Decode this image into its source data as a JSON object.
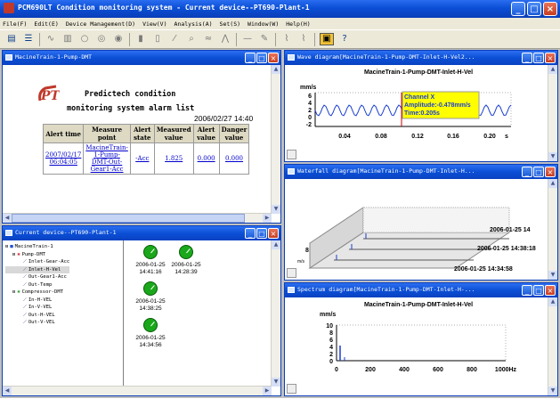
{
  "app": {
    "title": "PCM690LT Condition monitoring system  - Current device--PT690-Plant-1",
    "menu": [
      "File(F)",
      "Edit(E)",
      "Device Management(D)",
      "View(V)",
      "Analysis(A)",
      "Set(S)",
      "Window(W)",
      "Help(H)"
    ]
  },
  "alarm_window": {
    "title": "MacineTrain-1-Pump-DMT",
    "logo_text": "PT",
    "heading_line1": "Predictech condition",
    "heading_line2": "monitoring system alarm list",
    "datetime": "2006/02/27 14:40",
    "headers": [
      "Alert time",
      "Measure point",
      "Alert state",
      "Measured value",
      "Alert value",
      "Danger value"
    ],
    "row": [
      "2007/02/17 06:04:05",
      "MacineTrain-1-Pump-DMT-Out-Gear1-Acc",
      "-Acc",
      "1.825",
      "0.000",
      "0.000"
    ]
  },
  "device_window": {
    "title": "Current device--PT690-Plant-1",
    "tree": [
      {
        "label": "MacineTrain-1",
        "level": 0,
        "icon": "train-icon"
      },
      {
        "label": "Pump-DMT",
        "level": 1,
        "icon": "pump-icon"
      },
      {
        "label": "Inlet-Gear-Acc",
        "level": 2,
        "icon": "sensor-icon"
      },
      {
        "label": "Inlet-H-Vel",
        "level": 2,
        "icon": "sensor-icon"
      },
      {
        "label": "Out-Gear1-Acc",
        "level": 2,
        "icon": "sensor-icon"
      },
      {
        "label": "Out-Temp",
        "level": 2,
        "icon": "sensor-icon"
      },
      {
        "label": "Compressor-DMT",
        "level": 1,
        "icon": "compressor-icon"
      },
      {
        "label": "In-H-VEL",
        "level": 2,
        "icon": "sensor-icon"
      },
      {
        "label": "In-V-VEL",
        "level": 2,
        "icon": "sensor-icon"
      },
      {
        "label": "Out-H-VEL",
        "level": 2,
        "icon": "sensor-icon"
      },
      {
        "label": "Out-V-VEL",
        "level": 2,
        "icon": "sensor-icon"
      }
    ],
    "records": [
      {
        "date": "2006-01-25",
        "time": "14:41:16"
      },
      {
        "date": "2006-01-25",
        "time": "14:28:39"
      },
      {
        "date": "2006-01-25",
        "time": "14:38:25"
      },
      {
        "date": "2006-01-25",
        "time": "14:34:56"
      }
    ]
  },
  "wave_window": {
    "title": "Wave diagram[MacineTrain-1-Pump-DMT-Inlet-H-Vel2...",
    "chart_title": "MacineTrain-1-Pump-DMT-Inlet-H-Vel",
    "unit": "mm/s",
    "yticks": [
      "6",
      "4",
      "2",
      "0",
      "-2"
    ],
    "xticks": [
      "0.04",
      "0.08",
      "0.12",
      "0.16",
      "0.20"
    ],
    "xunit": "s",
    "tooltip": [
      "Channel X",
      "Amplitude:-0.478mm/s",
      "Time:0.205s"
    ],
    "accent": "#ffff00"
  },
  "waterfall_window": {
    "title": "Waterfall diagram[MacineTrain-1-Pump-DMT-Inlet-H...",
    "labels": [
      "2006-01-25 14",
      "2006-01-25 14:38:18",
      "2006-01-25 14:34:58"
    ],
    "zlabel": "8",
    "corner": "m/s"
  },
  "spectrum_window": {
    "title": "Spectrum diagram[MacineTrain-1-Pump-DMT-Inlet-H-...",
    "chart_title": "MacineTrain-1-Pump-DMT-Inlet-H-Vel",
    "unit": "mm/s",
    "yticks": [
      "10",
      "8",
      "6",
      "4",
      "2",
      "0"
    ],
    "xticks": [
      "0",
      "200",
      "400",
      "600",
      "800",
      "1000Hz"
    ]
  }
}
